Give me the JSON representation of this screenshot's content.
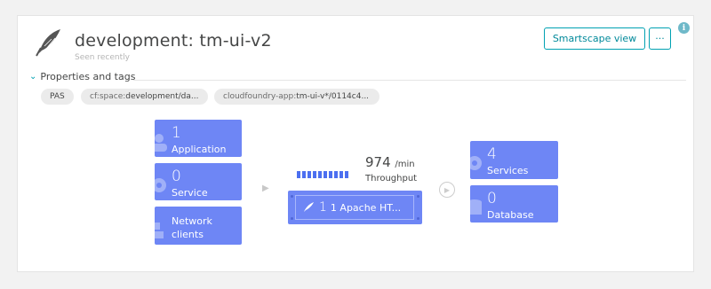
{
  "header": {
    "title": "development: tm-ui-v2",
    "subtitle": "Seen recently",
    "smartscape_label": "Smartscape view",
    "more_label": "···",
    "info_label": "i",
    "logo_icon": "apache-feather-icon"
  },
  "properties": {
    "toggle_label": "Properties and tags",
    "tags": [
      {
        "key": "",
        "value": "PAS"
      },
      {
        "key": "cf:space: ",
        "value": "development/da..."
      },
      {
        "key": "cloudfoundry-app: ",
        "value": "tm-ui-v*/0114c4..."
      }
    ]
  },
  "topology": {
    "left_tiles": [
      {
        "count": "1",
        "label": "Application",
        "icon": "application-icon"
      },
      {
        "count": "0",
        "label": "Service",
        "icon": "gear-icon"
      },
      {
        "count": "",
        "label": "Network\nclients",
        "icon": "network-icon"
      }
    ],
    "throughput": {
      "value": "974",
      "unit": "/min",
      "label": "Throughput"
    },
    "process": {
      "label": "1 Apache HT...",
      "icon": "apache-feather-icon"
    },
    "right_tiles": [
      {
        "count": "4",
        "label": "Services",
        "icon": "gear-icon"
      },
      {
        "count": "0",
        "label": "Database",
        "icon": "database-icon"
      }
    ]
  },
  "colors": {
    "accent": "#00a1b2",
    "tile": "#6e86f5",
    "bar": "#4c6ff0"
  }
}
